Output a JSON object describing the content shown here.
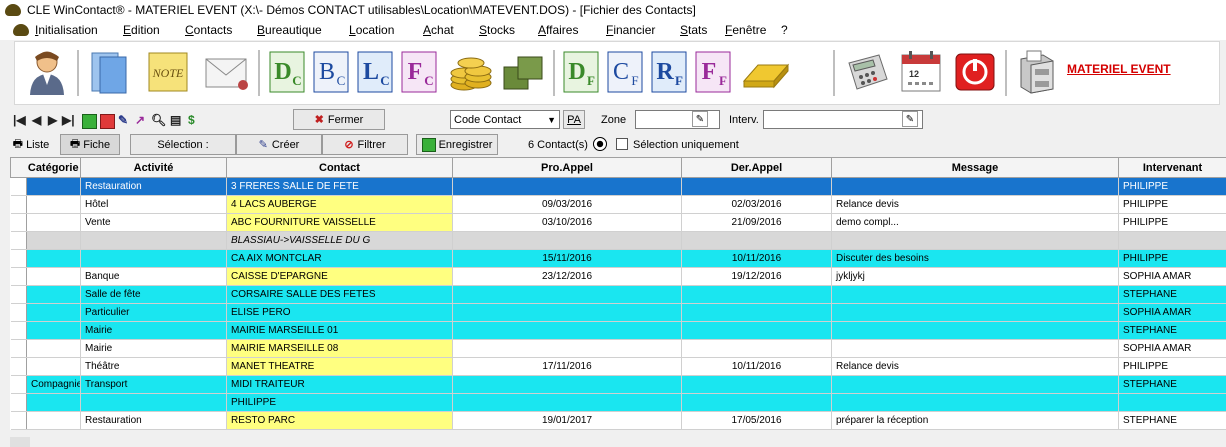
{
  "window": {
    "title": "CLE WinContact® - MATERIEL EVENT (X:\\- Démos CONTACT utilisables\\Location\\MATEVENT.DOS) - [Fichier des Contacts]"
  },
  "menu": [
    "Initialisation",
    "Edition",
    "Contacts",
    "Bureautique",
    "Location",
    "Achat",
    "Stocks",
    "Affaires",
    "Financier",
    "Stats",
    "Fenêtre",
    "?"
  ],
  "toolbar": {
    "letters": [
      {
        "main": "D",
        "sub": "C",
        "color": "#3a8a2a"
      },
      {
        "main": "B",
        "sub": "C",
        "color": "#1d4aa0"
      },
      {
        "main": "L",
        "sub": "C",
        "color": "#1d4aa0"
      },
      {
        "main": "F",
        "sub": "C",
        "color": "#9a2a9a"
      },
      {
        "main": "D",
        "sub": "F",
        "color": "#3a8a2a"
      },
      {
        "main": "C",
        "sub": "F",
        "color": "#1d4aa0"
      },
      {
        "main": "R",
        "sub": "F",
        "color": "#1d4aa0"
      },
      {
        "main": "F",
        "sub": "F",
        "color": "#9a2a9a"
      }
    ],
    "calendar_day": "12",
    "company_link": "MATERIEL EVENT"
  },
  "toolbar2": {
    "fermer": "Fermer",
    "combo_value": "Code Contact",
    "pa_label": "PA",
    "zone_label": "Zone",
    "zone_value": "",
    "interv_label": "Interv.",
    "interv_value": ""
  },
  "toolbar3": {
    "liste": "Liste",
    "fiche": "Fiche",
    "selection": "Sélection :",
    "creer": "Créer",
    "filtrer": "Filtrer",
    "enregistrer": "Enregistrer",
    "count": "6 Contact(s)",
    "selection_only": "Sélection uniquement"
  },
  "grid": {
    "headers": [
      "Catégorie",
      "Activité",
      "Contact",
      "Pro.Appel",
      "Der.Appel",
      "Message",
      "Intervenant"
    ],
    "rows": [
      {
        "style": "blue",
        "cat": "",
        "act": "Restauration",
        "contact": "3 FRERES SALLE DE FETE",
        "pro": "",
        "der": "",
        "msg": "",
        "interv": "PHILIPPE",
        "yellow": false,
        "italic": false
      },
      {
        "style": "white",
        "cat": "",
        "act": "Hôtel",
        "contact": "4 LACS AUBERGE",
        "pro": "09/03/2016",
        "der": "02/03/2016",
        "msg": "Relance devis",
        "interv": "PHILIPPE",
        "yellow": true,
        "italic": false
      },
      {
        "style": "white",
        "cat": "",
        "act": "Vente",
        "contact": "ABC FOURNITURE VAISSELLE",
        "pro": "03/10/2016",
        "der": "21/09/2016",
        "msg": "demo compl...",
        "interv": "PHILIPPE",
        "yellow": true,
        "italic": false
      },
      {
        "style": "grey",
        "cat": "",
        "act": "",
        "contact": "BLASSIAU->VAISSELLE DU G",
        "pro": "",
        "der": "",
        "msg": "",
        "interv": "",
        "yellow": false,
        "italic": true
      },
      {
        "style": "cyan",
        "cat": "",
        "act": "",
        "contact": "CA AIX MONTCLAR",
        "pro": "15/11/2016",
        "der": "10/11/2016",
        "msg": "Discuter des besoins",
        "interv": "PHILIPPE",
        "yellow": false,
        "italic": false
      },
      {
        "style": "white",
        "cat": "",
        "act": "Banque",
        "contact": "CAISSE D'EPARGNE",
        "pro": "23/12/2016",
        "der": "19/12/2016",
        "msg": "jykljykj",
        "interv": "SOPHIA  AMAR",
        "yellow": true,
        "italic": false
      },
      {
        "style": "cyan",
        "cat": "",
        "act": "Salle de fête",
        "contact": "CORSAIRE SALLE DES FETES",
        "pro": "",
        "der": "",
        "msg": "",
        "interv": "STEPHANE",
        "yellow": false,
        "italic": false
      },
      {
        "style": "cyan",
        "cat": "",
        "act": "Particulier",
        "contact": "ELISE PERO",
        "pro": "",
        "der": "",
        "msg": "",
        "interv": "SOPHIA  AMAR",
        "yellow": false,
        "italic": false
      },
      {
        "style": "cyan",
        "cat": "",
        "act": "Mairie",
        "contact": "MAIRIE MARSEILLE 01",
        "pro": "",
        "der": "",
        "msg": "",
        "interv": "STEPHANE",
        "yellow": false,
        "italic": false
      },
      {
        "style": "white",
        "cat": "",
        "act": "Mairie",
        "contact": "MAIRIE MARSEILLE 08",
        "pro": "",
        "der": "",
        "msg": "",
        "interv": "SOPHIA  AMAR",
        "yellow": true,
        "italic": false
      },
      {
        "style": "white",
        "cat": "",
        "act": "Théâtre",
        "contact": "MANET THEATRE",
        "pro": "17/11/2016",
        "der": "10/11/2016",
        "msg": "Relance devis",
        "interv": "PHILIPPE",
        "yellow": true,
        "italic": false
      },
      {
        "style": "cyan",
        "cat": "Compagnie",
        "act": "Transport",
        "contact": "MIDI TRAITEUR",
        "pro": "",
        "der": "",
        "msg": "",
        "interv": "STEPHANE",
        "yellow": false,
        "italic": false
      },
      {
        "style": "cyan",
        "cat": "",
        "act": "",
        "contact": "PHILIPPE",
        "pro": "",
        "der": "",
        "msg": "",
        "interv": "",
        "yellow": false,
        "italic": false
      },
      {
        "style": "white",
        "cat": "",
        "act": "Restauration",
        "contact": "RESTO PARC",
        "pro": "19/01/2017",
        "der": "17/05/2016",
        "msg": "préparer la réception",
        "interv": "STEPHANE",
        "yellow": true,
        "italic": false
      }
    ]
  }
}
